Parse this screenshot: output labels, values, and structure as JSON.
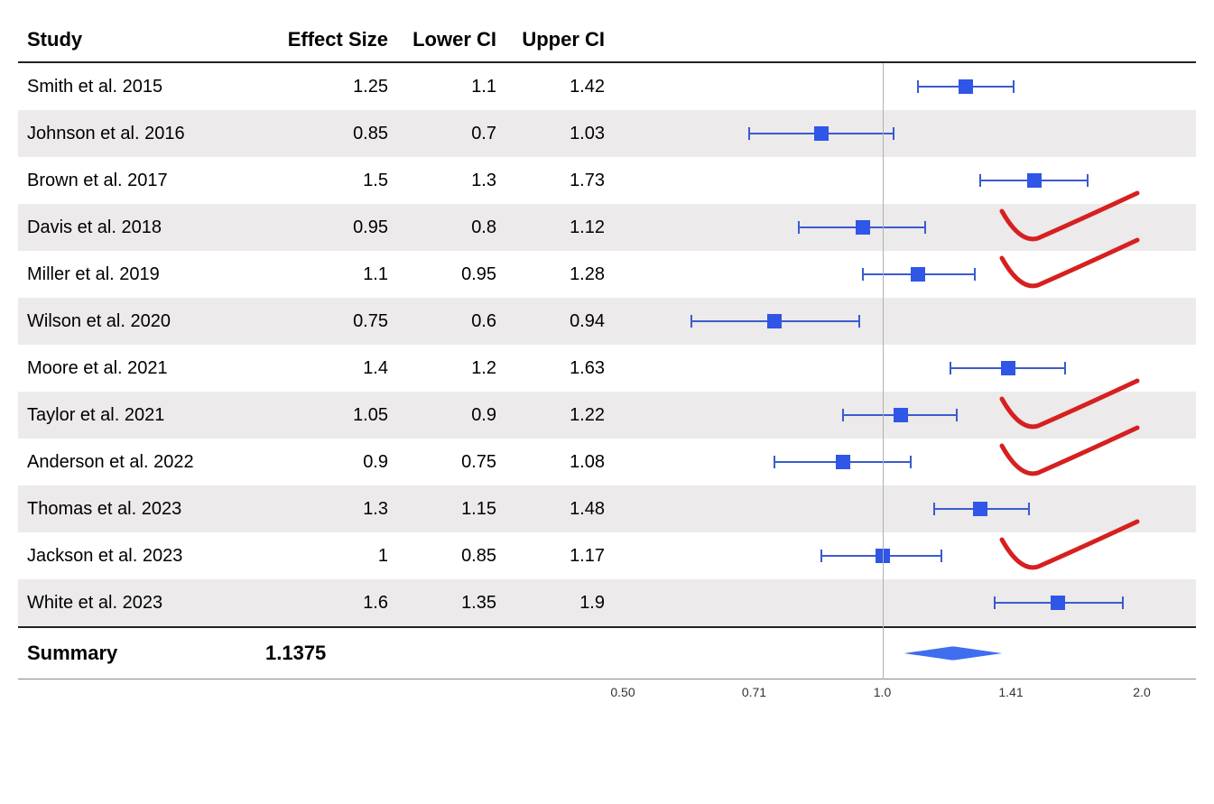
{
  "chart_data": {
    "type": "forest",
    "scale": "log",
    "xlim": [
      0.5,
      2.0
    ],
    "ticks": [
      0.5,
      0.71,
      1.0,
      1.41,
      2.0
    ],
    "tick_labels": [
      "0.50",
      "0.71",
      "1.0",
      "1.41",
      "2.0"
    ],
    "ref_line": 1.0,
    "columns": {
      "study": "Study",
      "es": "Effect Size",
      "lci": "Lower CI",
      "uci": "Upper CI"
    },
    "studies": [
      {
        "name": "Smith et al. 2015",
        "es": 1.25,
        "lci": 1.1,
        "uci": 1.42,
        "es_txt": "1.25",
        "lci_txt": "1.1",
        "uci_txt": "1.42"
      },
      {
        "name": "Johnson et al. 2016",
        "es": 0.85,
        "lci": 0.7,
        "uci": 1.03,
        "es_txt": "0.85",
        "lci_txt": "0.7",
        "uci_txt": "1.03"
      },
      {
        "name": "Brown et al. 2017",
        "es": 1.5,
        "lci": 1.3,
        "uci": 1.73,
        "es_txt": "1.5",
        "lci_txt": "1.3",
        "uci_txt": "1.73"
      },
      {
        "name": "Davis et al. 2018",
        "es": 0.95,
        "lci": 0.8,
        "uci": 1.12,
        "es_txt": "0.95",
        "lci_txt": "0.8",
        "uci_txt": "1.12"
      },
      {
        "name": "Miller et al. 2019",
        "es": 1.1,
        "lci": 0.95,
        "uci": 1.28,
        "es_txt": "1.1",
        "lci_txt": "0.95",
        "uci_txt": "1.28"
      },
      {
        "name": "Wilson et al. 2020",
        "es": 0.75,
        "lci": 0.6,
        "uci": 0.94,
        "es_txt": "0.75",
        "lci_txt": "0.6",
        "uci_txt": "0.94"
      },
      {
        "name": "Moore et al. 2021",
        "es": 1.4,
        "lci": 1.2,
        "uci": 1.63,
        "es_txt": "1.4",
        "lci_txt": "1.2",
        "uci_txt": "1.63"
      },
      {
        "name": "Taylor et al. 2021",
        "es": 1.05,
        "lci": 0.9,
        "uci": 1.22,
        "es_txt": "1.05",
        "lci_txt": "0.9",
        "uci_txt": "1.22"
      },
      {
        "name": "Anderson et al. 2022",
        "es": 0.9,
        "lci": 0.75,
        "uci": 1.08,
        "es_txt": "0.9",
        "lci_txt": "0.75",
        "uci_txt": "1.08"
      },
      {
        "name": "Thomas et al. 2023",
        "es": 1.3,
        "lci": 1.15,
        "uci": 1.48,
        "es_txt": "1.3",
        "lci_txt": "1.15",
        "uci_txt": "1.48"
      },
      {
        "name": "Jackson et al. 2023",
        "es": 1.0,
        "lci": 0.85,
        "uci": 1.17,
        "es_txt": "1",
        "lci_txt": "0.85",
        "uci_txt": "1.17"
      },
      {
        "name": "White et al. 2023",
        "es": 1.6,
        "lci": 1.35,
        "uci": 1.9,
        "es_txt": "1.6",
        "lci_txt": "1.35",
        "uci_txt": "1.9"
      }
    ],
    "summary": {
      "label": "Summary",
      "es": 1.1375,
      "es_txt": "1.1375",
      "lci": 1.0,
      "uci": 1.3
    },
    "annotations": [
      {
        "row": 3
      },
      {
        "row": 4
      },
      {
        "row": 7
      },
      {
        "row": 8
      },
      {
        "row": 10
      }
    ]
  }
}
